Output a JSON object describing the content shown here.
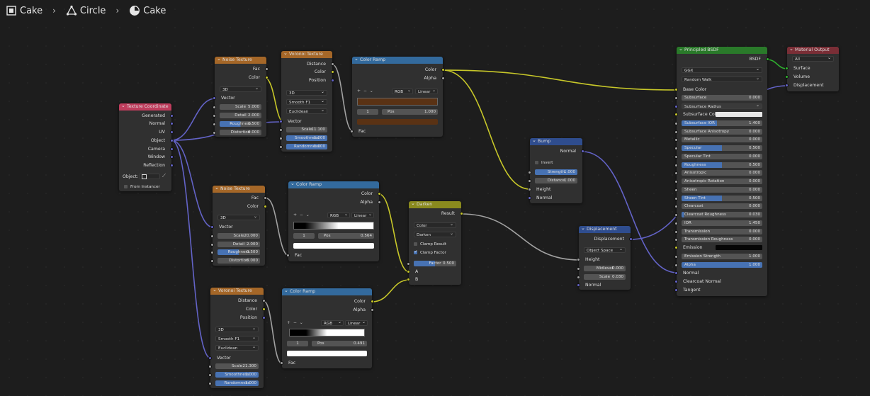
{
  "breadcrumb": {
    "items": [
      "Cake",
      "Circle",
      "Cake"
    ]
  },
  "colors": {
    "texture": "#bf3d5d",
    "color": "#a56728",
    "vector": "#336a9d",
    "shader": "#2a7a2a",
    "output": "#7a2e36",
    "converter": "#2f4d8e",
    "wire_color": "#c7c729",
    "wire_float": "#a1a1a1",
    "wire_vector": "#6363c7"
  },
  "nodes": {
    "texcoord": {
      "title": "Texture Coordinate",
      "outputs": [
        "Generated",
        "Normal",
        "UV",
        "Object",
        "Camera",
        "Window",
        "Reflection"
      ],
      "object_label": "Object:",
      "from_instancer": "From Instancer"
    },
    "noise1": {
      "title": "Noise Texture",
      "outputs": [
        "Fac",
        "Color"
      ],
      "dim": "3D",
      "vector": "Vector",
      "fields": [
        {
          "label": "Scale",
          "value": "5.000"
        },
        {
          "label": "Detail",
          "value": "2.000"
        },
        {
          "label": "Roughness",
          "value": "0.500"
        },
        {
          "label": "Distortion",
          "value": "0.000"
        }
      ]
    },
    "voronoi1": {
      "title": "Voronoi Texture",
      "outputs": [
        "Distance",
        "Color",
        "Position"
      ],
      "dim": "3D",
      "feature": "Smooth F1",
      "metric": "Euclidean",
      "vector": "Vector",
      "fields": [
        {
          "label": "Scale",
          "value": "11.100"
        },
        {
          "label": "Smoothness",
          "value": "1.000"
        },
        {
          "label": "Randomness",
          "value": "1.000"
        }
      ]
    },
    "ramp1": {
      "title": "Color Ramp",
      "outputs": [
        "Color",
        "Alpha"
      ],
      "mode": "RGB",
      "interp": "Linear",
      "index": "1",
      "pos_label": "Pos",
      "pos": "1.000",
      "input": "Fac"
    },
    "noise2": {
      "title": "Noise Texture",
      "outputs": [
        "Fac",
        "Color"
      ],
      "dim": "3D",
      "vector": "Vector",
      "fields": [
        {
          "label": "Scale",
          "value": "20.000"
        },
        {
          "label": "Detail",
          "value": "2.000"
        },
        {
          "label": "Roughness",
          "value": "0.500"
        },
        {
          "label": "Distortion",
          "value": "0.000"
        }
      ]
    },
    "ramp2": {
      "title": "Color Ramp",
      "outputs": [
        "Color",
        "Alpha"
      ],
      "mode": "RGB",
      "interp": "Linear",
      "index": "1",
      "pos_label": "Pos",
      "pos": "0.564",
      "input": "Fac"
    },
    "voronoi2": {
      "title": "Voronoi Texture",
      "outputs": [
        "Distance",
        "Color",
        "Position"
      ],
      "dim": "3D",
      "feature": "Smooth F1",
      "metric": "Euclidean",
      "vector": "Vector",
      "fields": [
        {
          "label": "Scale",
          "value": "21.300"
        },
        {
          "label": "Smoothness",
          "value": "1.000"
        },
        {
          "label": "Randomness",
          "value": "1.000"
        }
      ]
    },
    "ramp3": {
      "title": "Color Ramp",
      "outputs": [
        "Color",
        "Alpha"
      ],
      "mode": "RGB",
      "interp": "Linear",
      "index": "1",
      "pos_label": "Pos",
      "pos": "0.491",
      "input": "Fac"
    },
    "darken": {
      "title": "Darken",
      "output": "Result",
      "type": "Color",
      "blend": "Darken",
      "clamp_result": "Clamp Result",
      "clamp_factor": "Clamp Factor",
      "factor_label": "Factor",
      "factor": "0.500",
      "inputs": [
        "A",
        "B"
      ]
    },
    "bump": {
      "title": "Bump",
      "output": "Normal",
      "invert": "Invert",
      "fields": [
        {
          "label": "Strength",
          "value": "1.000"
        },
        {
          "label": "Distance",
          "value": "1.000"
        }
      ],
      "inputs": [
        "Height",
        "Normal"
      ]
    },
    "displacement": {
      "title": "Displacement",
      "output": "Displacement",
      "space": "Object Space",
      "inputs": [
        "Height"
      ],
      "fields": [
        {
          "label": "Midlevel",
          "value": "0.000"
        },
        {
          "label": "Scale",
          "value": "0.030"
        }
      ],
      "normal": "Normal"
    },
    "bsdf": {
      "title": "Principled BSDF",
      "output": "BSDF",
      "distribution": "GGX",
      "subsurface_method": "Random Walk",
      "base_color": "Base Color",
      "rows": [
        {
          "label": "Subsurface",
          "value": "0.000"
        },
        {
          "label": "Subsurface Radius",
          "value": ""
        },
        {
          "label": "Subsurface Color",
          "value": ""
        },
        {
          "label": "Subsurface IOR",
          "value": "1.400"
        },
        {
          "label": "Subsurface Anisotropy",
          "value": "0.000"
        },
        {
          "label": "Metallic",
          "value": "0.000"
        },
        {
          "label": "Specular",
          "value": "0.500"
        },
        {
          "label": "Specular Tint",
          "value": "0.000"
        },
        {
          "label": "Roughness",
          "value": "0.500"
        },
        {
          "label": "Anisotropic",
          "value": "0.000"
        },
        {
          "label": "Anisotropic Rotation",
          "value": "0.000"
        },
        {
          "label": "Sheen",
          "value": "0.000"
        },
        {
          "label": "Sheen Tint",
          "value": "0.500"
        },
        {
          "label": "Clearcoat",
          "value": "0.000"
        },
        {
          "label": "Clearcoat Roughness",
          "value": "0.030"
        },
        {
          "label": "IOR",
          "value": "1.450"
        },
        {
          "label": "Transmission",
          "value": "0.000"
        },
        {
          "label": "Transmission Roughness",
          "value": "0.000"
        },
        {
          "label": "Emission",
          "value": ""
        },
        {
          "label": "Emission Strength",
          "value": "1.000"
        },
        {
          "label": "Alpha",
          "value": "1.000"
        }
      ],
      "inputs_bottom": [
        "Normal",
        "Clearcoat Normal",
        "Tangent"
      ]
    },
    "output": {
      "title": "Material Output",
      "target": "All",
      "inputs": [
        "Surface",
        "Volume",
        "Displacement"
      ]
    }
  }
}
